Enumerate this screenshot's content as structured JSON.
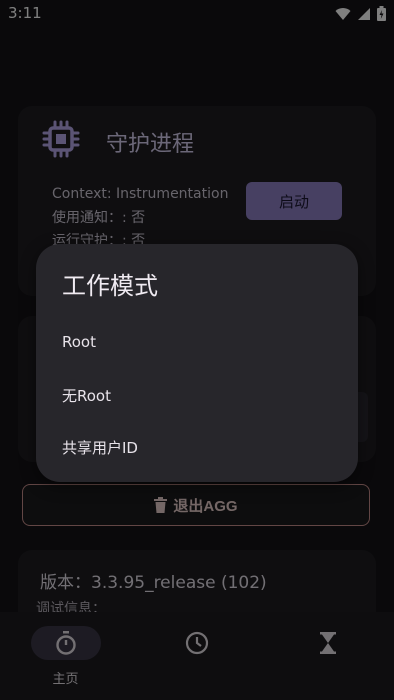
{
  "status_bar": {
    "time": "3:11",
    "icons": [
      "wifi-icon",
      "signal-icon",
      "battery-icon"
    ]
  },
  "guard_card": {
    "title": "守护进程",
    "icon": "chip-icon",
    "context_line": "Context: Instrumentation",
    "notify_line": "使用通知：: 否",
    "guard_line": "运行守护：: 否",
    "start_label": "启动"
  },
  "exit_button": {
    "label": "退出AGG",
    "icon": "trash-icon"
  },
  "version_card": {
    "version_text": "版本：3.3.95_release (102)",
    "debug_text": "调试信息："
  },
  "dialog": {
    "title": "工作模式",
    "options": [
      "Root",
      "无Root",
      "共享用户ID"
    ]
  },
  "bottom_nav": {
    "items": [
      {
        "label": "主页",
        "icon": "stopwatch-icon",
        "active": true
      },
      {
        "label": "",
        "icon": "clock-icon",
        "active": false
      },
      {
        "label": "",
        "icon": "hourglass-icon",
        "active": false
      }
    ]
  },
  "colors": {
    "accent": "#8e80c4",
    "danger_outline": "#c48d8a",
    "surface": "#1e1d21",
    "background": "#141316"
  }
}
